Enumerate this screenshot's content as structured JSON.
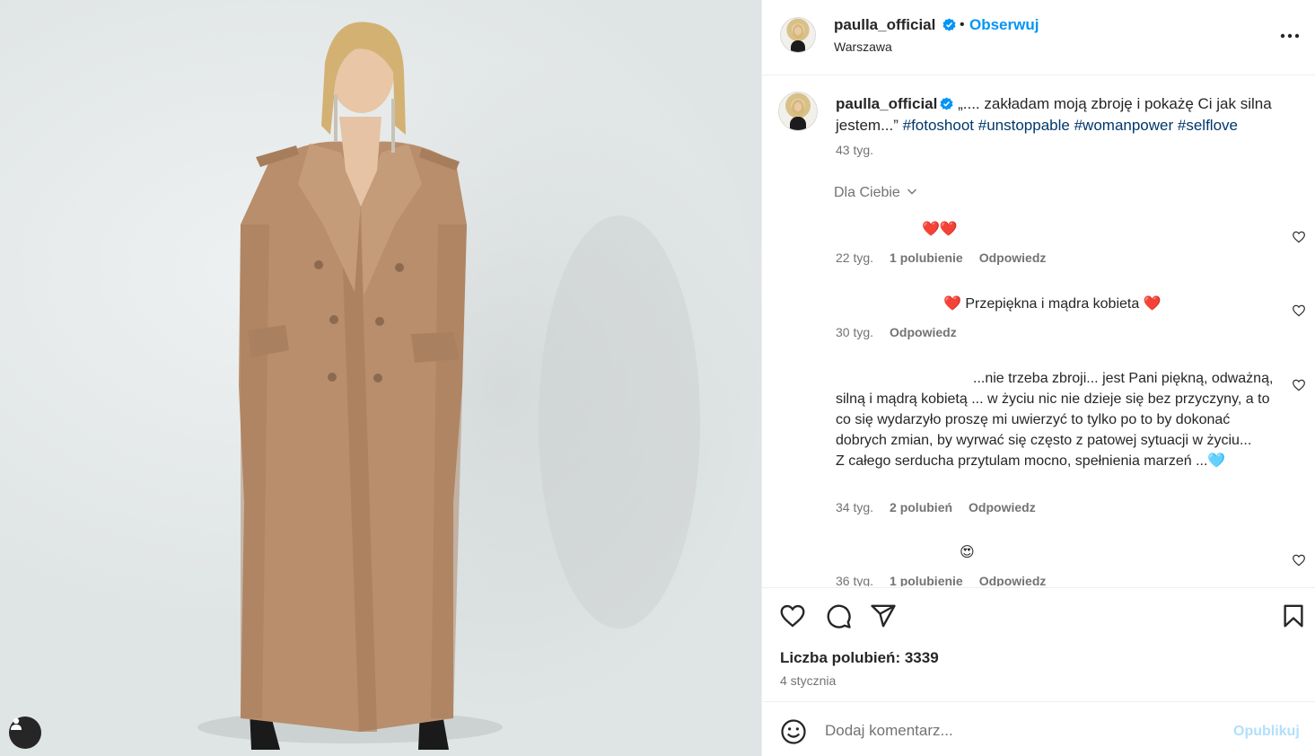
{
  "post": {
    "username": "paulla_official",
    "verified": true,
    "separator": "•",
    "follow_label": "Obserwuj",
    "location": "Warszawa",
    "more_icon": "more-horizontal-icon"
  },
  "caption": {
    "username": "paulla_official",
    "text": " „.... zakładam moją zbroję i pokażę Ci jak silna jestem...” ",
    "hashtags": [
      "#fotoshoot",
      "#unstoppable",
      "#womanpower",
      "#selflove"
    ],
    "time": "43 tyg."
  },
  "filter": {
    "label": "Dla Ciebie"
  },
  "comments": [
    {
      "text": "❤️❤️",
      "time": "22 tyg.",
      "likes": "1 polubienie",
      "reply": "Odpowiedz"
    },
    {
      "text": "❤️ Przepiękna i mądra kobieta ❤️",
      "time": "30 tyg.",
      "likes": "",
      "reply": "Odpowiedz"
    },
    {
      "text": "...nie trzeba zbroji... jest Pani piękną, odważną, silną i mądrą kobietą ... w życiu nic nie dzieje się bez przyczyny, a to co się wydarzyło proszę mi uwierzyć to tylko po to by dokonać dobrych zmian, by wyrwać się często z patowej sytuacji w życiu...\nZ całego serducha przytulam mocno, spełnienia marzeń ...🩵",
      "time": "34 tyg.",
      "likes": "2 polubień",
      "reply": "Odpowiedz"
    },
    {
      "text": "😍",
      "time": "36 tyg.",
      "likes": "1 polubienie",
      "reply": "Odpowiedz"
    }
  ],
  "actions": {
    "icons": [
      "heart-icon",
      "comment-icon",
      "share-icon",
      "bookmark-icon"
    ],
    "likes_text": "Liczba polubień: 3339",
    "date": "4 stycznia"
  },
  "add_comment": {
    "placeholder": "Dodaj komentarz...",
    "publish_label": "Opublikuj"
  },
  "colors": {
    "accent": "#0095f6",
    "hashtag": "#00376b",
    "muted": "#737373",
    "verified": "#0095f6",
    "heart_red": "#ff3040"
  }
}
